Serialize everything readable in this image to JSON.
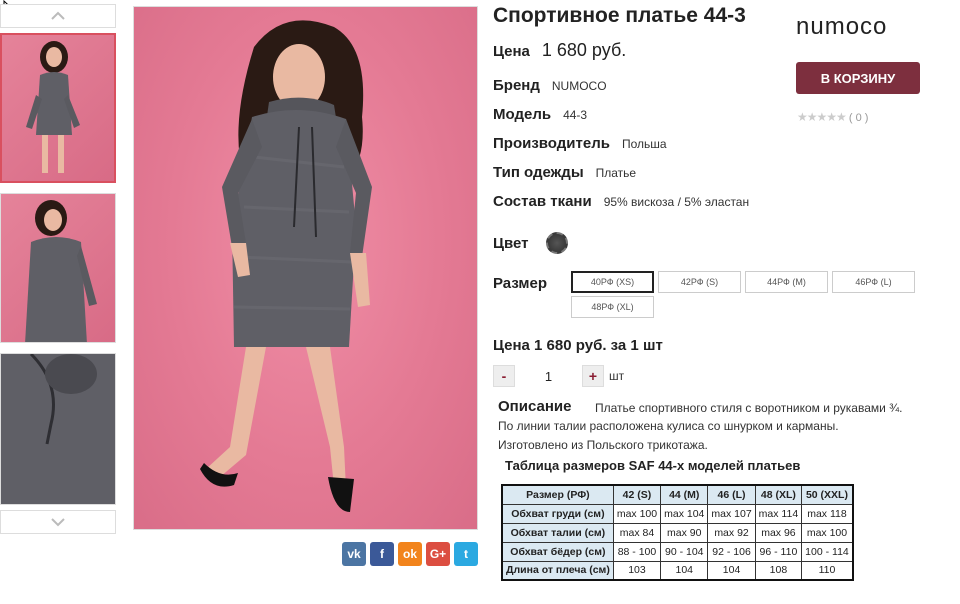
{
  "product": {
    "title": "Спортивное платье 44-3",
    "brand_logo": "NUMOCO",
    "cart_button": "В КОРЗИНУ",
    "rating": {
      "stars": "★★★★★",
      "count": "( 0 )"
    }
  },
  "specs": {
    "price_label": "Цена",
    "price_value": "1 680 руб.",
    "brand_label": "Бренд",
    "brand_value": "NUMOCO",
    "model_label": "Модель",
    "model_value": "44-3",
    "maker_label": "Производитель",
    "maker_value": "Польша",
    "type_label": "Тип одежды",
    "type_value": "Платье",
    "fabric_label": "Состав ткани",
    "fabric_value": "95% вискоза / 5% эластан",
    "color_label": "Цвет",
    "size_label": "Размер"
  },
  "sizes": [
    "40РФ (XS)",
    "42РФ (S)",
    "44РФ (M)",
    "46РФ (L)",
    "48РФ (XL)"
  ],
  "order": {
    "total": "Цена 1 680 руб. за 1 шт",
    "minus": "-",
    "qty": "1",
    "plus": "+",
    "unit": "шт"
  },
  "description": {
    "heading": "Описание",
    "line1": "Платье спортивного стиля с воротником и рукавами ¾.",
    "line2": "По линии талии расположена кулиса со шнурком и карманы.",
    "line3": "Изготовлено из Польского трикотажа."
  },
  "size_table": {
    "title": "Таблица размеров SAF 44-х моделей платьев",
    "headers": [
      "Размер (РФ)",
      "42 (S)",
      "44 (M)",
      "46 (L)",
      "48 (XL)",
      "50 (XXL)"
    ],
    "rows": [
      [
        "Обхват груди (см)",
        "max 100",
        "max 104",
        "max 107",
        "max 114",
        "max 118"
      ],
      [
        "Обхват талии (см)",
        "max 84",
        "max 90",
        "max 92",
        "max 96",
        "max 100"
      ],
      [
        "Обхват бёдер (см)",
        "88 - 100",
        "90 - 104",
        "92 - 106",
        "96 - 110",
        "100 - 114"
      ],
      [
        "Длина от плеча (см)",
        "103",
        "104",
        "104",
        "108",
        "110"
      ]
    ]
  },
  "share": [
    {
      "name": "vk",
      "glyph": "vk",
      "color": "#4c75a3"
    },
    {
      "name": "facebook",
      "glyph": "f",
      "color": "#3b5998"
    },
    {
      "name": "odnoklassniki",
      "glyph": "ok",
      "color": "#f2841c"
    },
    {
      "name": "google-plus",
      "glyph": "G+",
      "color": "#dc4e41"
    },
    {
      "name": "twitter",
      "glyph": "t",
      "color": "#2ba9e1"
    }
  ],
  "icons": {
    "nav_up": "chevron-up",
    "nav_down": "chevron-down"
  }
}
